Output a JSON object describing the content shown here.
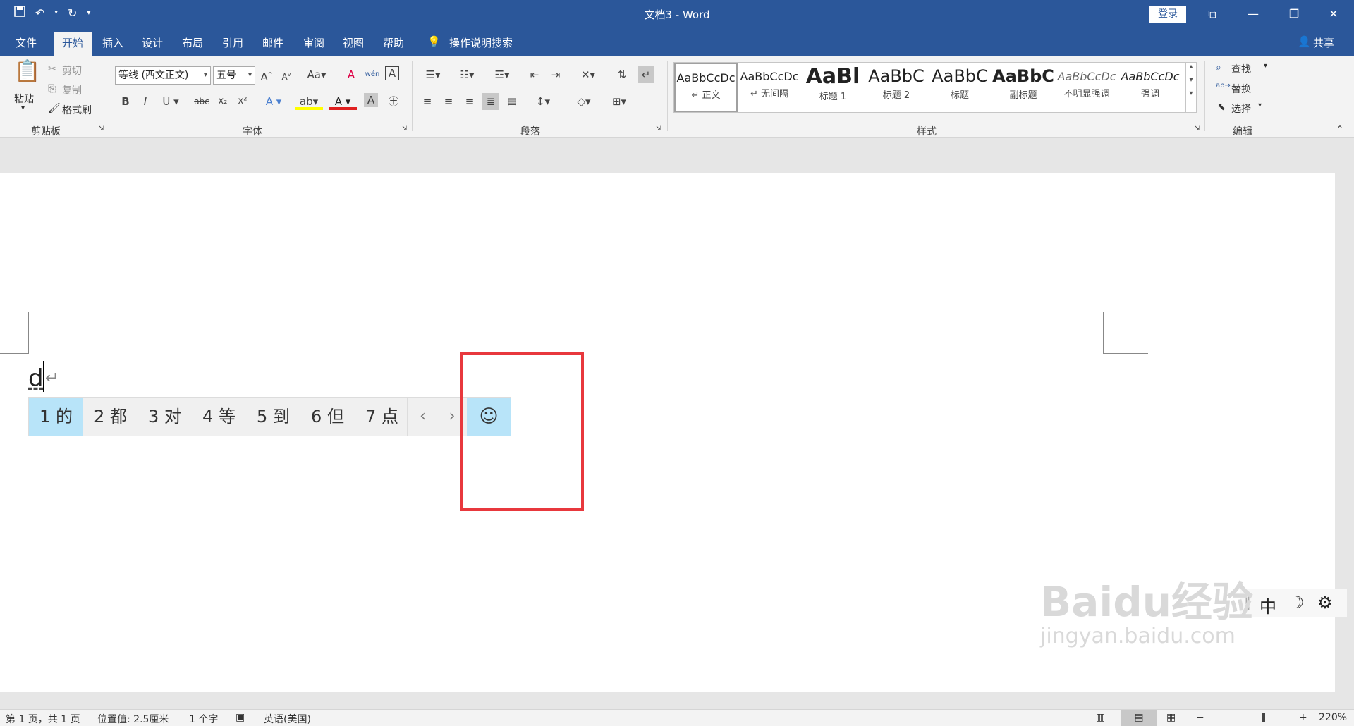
{
  "titlebar": {
    "doc_title": "文档3 - Word",
    "login_label": "登录",
    "qat_icons": [
      "save-icon",
      "undo-icon",
      "redo-icon",
      "customize-icon"
    ]
  },
  "menu": {
    "tabs": [
      "文件",
      "开始",
      "插入",
      "设计",
      "布局",
      "引用",
      "邮件",
      "审阅",
      "视图",
      "帮助"
    ],
    "active_tab": "开始",
    "tell_me": "操作说明搜索",
    "share": "共享"
  },
  "ribbon": {
    "clipboard": {
      "label": "剪贴板",
      "paste": "粘贴",
      "cut": "剪切",
      "copy": "复制",
      "format_painter": "格式刷"
    },
    "font": {
      "label": "字体",
      "font_name": "等线 (西文正文)",
      "font_size": "五号"
    },
    "paragraph": {
      "label": "段落"
    },
    "styles": {
      "label": "样式",
      "items": [
        {
          "sample": "AaBbCcDc",
          "name": "↵ 正文"
        },
        {
          "sample": "AaBbCcDc",
          "name": "↵ 无间隔"
        },
        {
          "sample": "AaBl",
          "name": "标题 1"
        },
        {
          "sample": "AaBbC",
          "name": "标题 2"
        },
        {
          "sample": "AaBbC",
          "name": "标题"
        },
        {
          "sample": "AaBbC",
          "name": "副标题"
        },
        {
          "sample": "AaBbCcDc",
          "name": "不明显强调"
        },
        {
          "sample": "AaBbCcDc",
          "name": "强调"
        }
      ]
    },
    "editing": {
      "label": "编辑",
      "find": "查找",
      "replace": "替换",
      "select": "选择"
    }
  },
  "document": {
    "typed_text": "d",
    "ime": {
      "candidates": [
        "1 的",
        "2 都",
        "3 对",
        "4 等",
        "5 到",
        "6 但",
        "7 点"
      ],
      "selected_index": 0,
      "emoji": "☺"
    },
    "ime_toolbar": {
      "mode": "中"
    }
  },
  "watermark": {
    "line1": "Baidu经验",
    "line2": "jingyan.baidu.com"
  },
  "status": {
    "page": "第 1 页，共 1 页",
    "position": "位置值: 2.5厘米",
    "words": "1 个字",
    "language": "英语(美国)",
    "zoom": "220%"
  },
  "colors": {
    "brand": "#2b579a",
    "highlight_box": "#e8383d",
    "ime_selected": "#b8e4f9"
  }
}
